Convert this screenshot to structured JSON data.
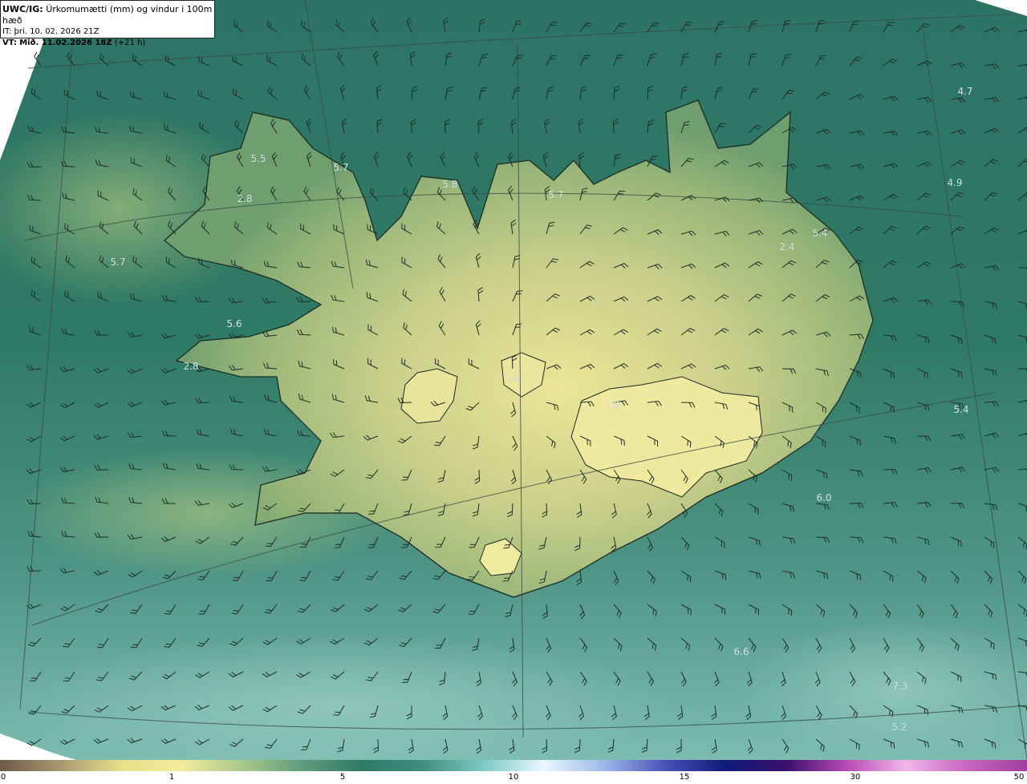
{
  "header": {
    "product": "UWC/IG:",
    "title": "Úrkomumætti (mm) og vindur i 100m hæð",
    "it_label": "IT:",
    "it_value": "þri. 10. 02. 2026 21Z",
    "vt_label": "VT:",
    "vt_value": "Mið. 11.02.2026 18Z",
    "vt_suffix": "(+21 h)"
  },
  "value_labels": [
    "4.7",
    "4.9",
    "5.5",
    "5.7",
    "2.8",
    "5.8",
    "5.7",
    "5.4",
    "2.4",
    "5.7",
    "5.6",
    "2.8",
    "1.0",
    "1.0",
    "5.4",
    "6.0",
    "6.6",
    "7.3",
    "5.2"
  ],
  "colorbar": {
    "ticks": [
      "0",
      "1",
      "5",
      "10",
      "15",
      "30",
      "50"
    ],
    "colors": [
      "#6e5a48",
      "#a99870",
      "#e6e08a",
      "#f3eb9a",
      "#a9c98c",
      "#5f9c7c",
      "#2e7a64",
      "#3f8f80",
      "#7fc8c4",
      "#e8f8ff",
      "#9fb8e8",
      "#4a52b8",
      "#101a78",
      "#3a0f6e",
      "#b84ab4",
      "#f2b6e8",
      "#c865c0",
      "#a43d9e"
    ]
  },
  "colors": {
    "sea_dark": "#2d6e61",
    "sea_light": "#5fa293",
    "land_low": "#8cae74",
    "land_high": "#e8e497",
    "coast": "#1b2b25",
    "grid": "#3a4a45",
    "barb": "#1e2d28"
  }
}
